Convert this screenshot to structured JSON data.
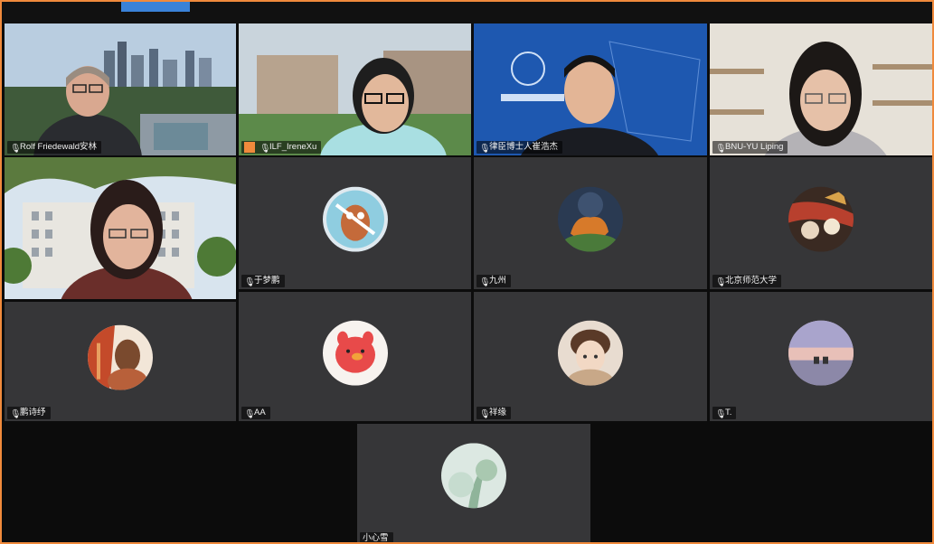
{
  "participants": [
    {
      "name": "Rolf Friedewald安林"
    },
    {
      "name": "ILF_IreneXu"
    },
    {
      "name": "律臣博士人崔浩杰"
    },
    {
      "name": "BNU-YU Liping"
    },
    {
      "name": ""
    },
    {
      "name": "于梦鹏"
    },
    {
      "name": "九州"
    },
    {
      "name": "北京师范大学"
    },
    {
      "name": "鹏诗纾"
    },
    {
      "name": "AA"
    },
    {
      "name": "祥缘"
    },
    {
      "name": "T."
    },
    {
      "name": "小心雪"
    }
  ],
  "icons": {
    "mic": "mic-icon",
    "host": "host-badge-icon"
  },
  "colors": {
    "border": "#f08a3c",
    "tile": "#363638",
    "background": "#0c0c0c"
  }
}
